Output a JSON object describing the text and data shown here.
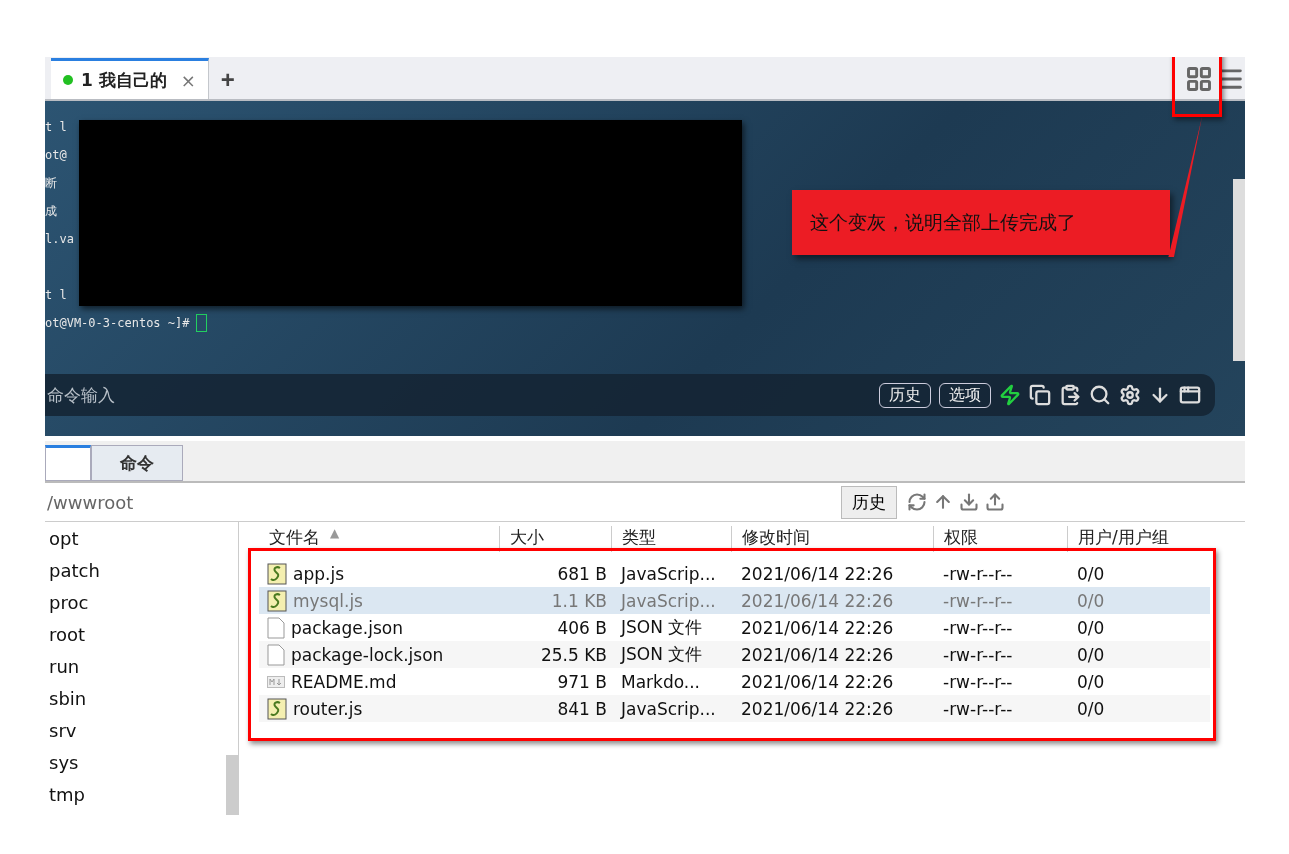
{
  "session_tabs": [
    {
      "label": "1 我自己的",
      "connected": true,
      "selected": true,
      "close": "×"
    }
  ],
  "new_tab": "+",
  "terminal": {
    "blocks": [
      {
        "lines": [
          "t l",
          "ot@",
          "断",
          "成",
          "l.va"
        ]
      },
      {
        "lines": [
          "t l",
          "ot@VM-0-3-centos ~]#"
        ]
      }
    ]
  },
  "annotation": {
    "callout": "这个变灰，说明全部上传完成了"
  },
  "command_bar": {
    "placeholder": "命令输入",
    "buttons": [
      "历史",
      "选项"
    ]
  },
  "panel_tabs": [
    {
      "selected": true
    },
    {
      "label": "命令",
      "selected": false
    }
  ],
  "path_bar": {
    "path": "/wwwroot",
    "history": "历史"
  },
  "tree": {
    "items": [
      "opt",
      "patch",
      "proc",
      "root",
      "run",
      "sbin",
      "srv",
      "sys",
      "tmp"
    ]
  },
  "table": {
    "columns": [
      {
        "label": "文件名",
        "sort": "▲"
      },
      {
        "label": "大小"
      },
      {
        "label": "类型"
      },
      {
        "label": "修改时间"
      },
      {
        "label": "权限"
      },
      {
        "label": "用户/用户组"
      }
    ],
    "rows": [
      {
        "kind": "script",
        "name": "app.js",
        "size": "681 B",
        "type": "JavaScrip...",
        "modified": "2021/06/14 22:26",
        "perms": "-rw-r--r--",
        "owner": "0/0",
        "selected": false
      },
      {
        "kind": "script",
        "name": "mysql.js",
        "size": "1.1 KB",
        "type": "JavaScrip...",
        "modified": "2021/06/14 22:26",
        "perms": "-rw-r--r--",
        "owner": "0/0",
        "selected": true
      },
      {
        "kind": "file",
        "name": "package.json",
        "size": "406 B",
        "type": "JSON 文件",
        "modified": "2021/06/14 22:26",
        "perms": "-rw-r--r--",
        "owner": "0/0",
        "selected": false
      },
      {
        "kind": "file",
        "name": "package-lock.json",
        "size": "25.5 KB",
        "type": "JSON 文件",
        "modified": "2021/06/14 22:26",
        "perms": "-rw-r--r--",
        "owner": "0/0",
        "selected": false
      },
      {
        "kind": "markdown",
        "name": "README.md",
        "size": "971 B",
        "type": "Markdo...",
        "modified": "2021/06/14 22:26",
        "perms": "-rw-r--r--",
        "owner": "0/0",
        "selected": false
      },
      {
        "kind": "script",
        "name": "router.js",
        "size": "841 B",
        "type": "JavaScrip...",
        "modified": "2021/06/14 22:26",
        "perms": "-rw-r--r--",
        "owner": "0/0",
        "selected": false
      }
    ]
  }
}
